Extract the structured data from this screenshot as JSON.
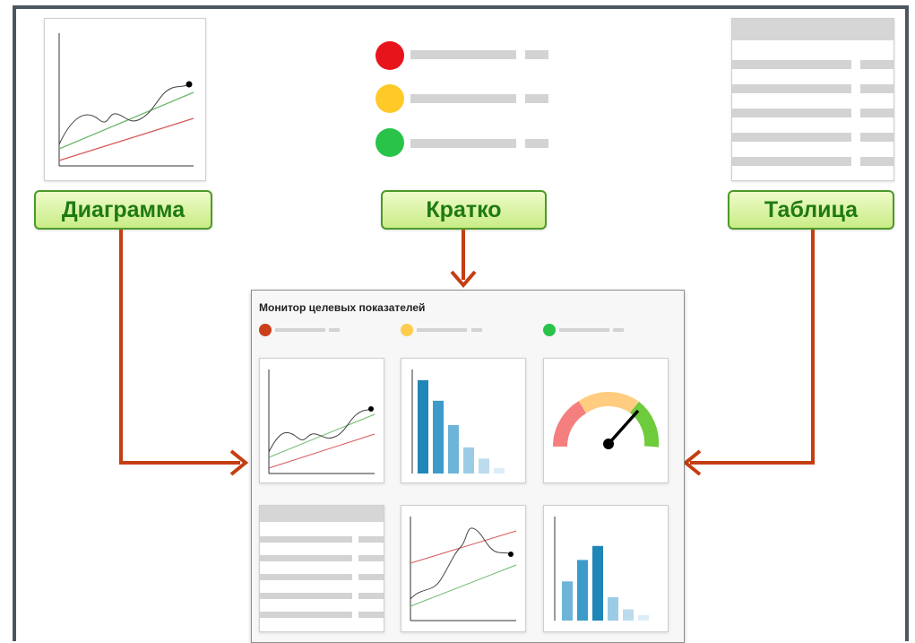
{
  "labels": {
    "chart": "Диаграмма",
    "summary": "Кратко",
    "table": "Таблица"
  },
  "monitor": {
    "title": "Монитор целевых показателей"
  },
  "colors": {
    "arrow": "#c43e12",
    "label_text": "#1f7a12",
    "status_red": "#e8141c",
    "status_yellow": "#ffc928",
    "status_green": "#2ac34a",
    "bar_blue": "#2e97c6",
    "line_green": "#6db86b",
    "line_red": "#d7595a"
  },
  "status_lights": [
    "red",
    "yellow",
    "green"
  ],
  "mini_bar_chart_1": [
    100,
    78,
    52,
    28,
    16,
    6
  ],
  "mini_bar_chart_2": [
    42,
    65,
    80,
    25,
    12,
    6
  ],
  "gauge": {
    "segments": [
      "red",
      "yellow",
      "green"
    ]
  }
}
